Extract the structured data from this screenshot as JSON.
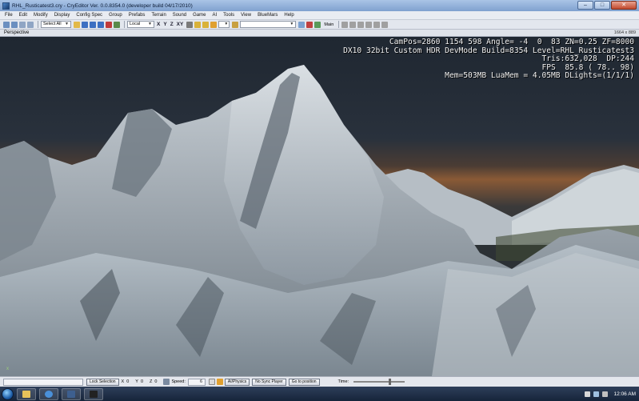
{
  "window": {
    "title": "RHL_Rusticatest3.cry - CryEditor Ver. 0.0.8354.0 (developer build 04/17/2010)",
    "minimize": "–",
    "maximize": "□",
    "close": "✕"
  },
  "menu": [
    "File",
    "Edit",
    "Modify",
    "Display",
    "Config Spec",
    "Group",
    "Prefabs",
    "Terrain",
    "Sound",
    "Game",
    "AI",
    "Tools",
    "View",
    "BlueMars",
    "Help"
  ],
  "toolbar": {
    "select_all": "Select All",
    "coord_system": "Local",
    "axes": [
      "X",
      "Y",
      "Z",
      "XY"
    ],
    "main_label": "Main"
  },
  "viewport": {
    "title": "Perspective",
    "resolution": "1664 x 889",
    "debug_lines": [
      "CamPos=2860 1154 598 Angle= -4  0  83 ZN=0.25 ZF=8000",
      "DX10 32bit Custom HDR DevMode Build=8354 Level=RHL_Rusticatest3",
      "Tris:632,028  DP:244",
      "FPS  85.8 ( 78.. 98)",
      "Mem=503MB LuaMem = 4.05MB DLights=(1/1/1)"
    ],
    "axis_gizmo": "x"
  },
  "statusbar": {
    "lock_selection": "Lock Selection",
    "x_label": "X",
    "x_value": "0",
    "y_label": "Y",
    "y_value": "0",
    "z_label": "Z",
    "z_value": "0",
    "speed_label": "Speed:",
    "speed_value": "6",
    "ai_physics": "AI/Physics",
    "no_sync_player": "No Sync Player",
    "go_to_position": "Go to position",
    "time_label": "Time:"
  },
  "taskbar": {
    "clock": "12:06 AM"
  }
}
